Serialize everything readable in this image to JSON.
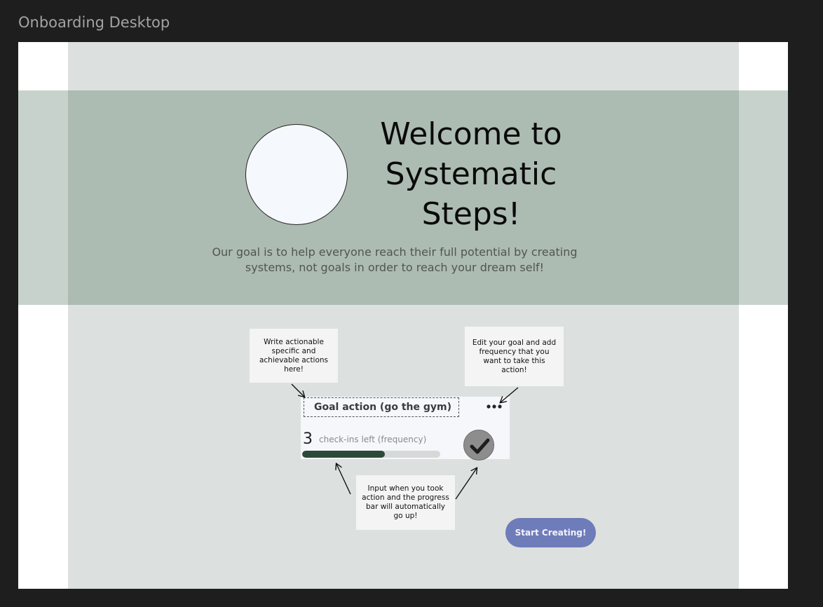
{
  "frame": {
    "label": "Onboarding Desktop"
  },
  "hero": {
    "title_lines": [
      "Welcome to",
      "Systematic",
      "Steps!"
    ],
    "subtitle": "Our goal is to help everyone reach their full potential by creating systems, not goals in order to reach your dream self!"
  },
  "annotations": {
    "action_note": "Write actionable specific and achievable actions here!",
    "edit_note": "Edit your goal and add frequency that you want to take this action!",
    "input_note": "Input when you took action and the progress bar will automatically go up!"
  },
  "goal_card": {
    "title": "Goal action (go the gym)",
    "checkins_count": "3",
    "checkins_label": "check-ins left (frequency)",
    "progress_fraction": 0.6,
    "more_icon": "ellipsis-icon",
    "check_icon": "checkmark-icon"
  },
  "cta": {
    "label": "Start Creating!"
  },
  "colors": {
    "background": "#1e1e1e",
    "hero": "#adbcb3",
    "progress": "#2c4a3a",
    "cta": "#6f7cba"
  }
}
